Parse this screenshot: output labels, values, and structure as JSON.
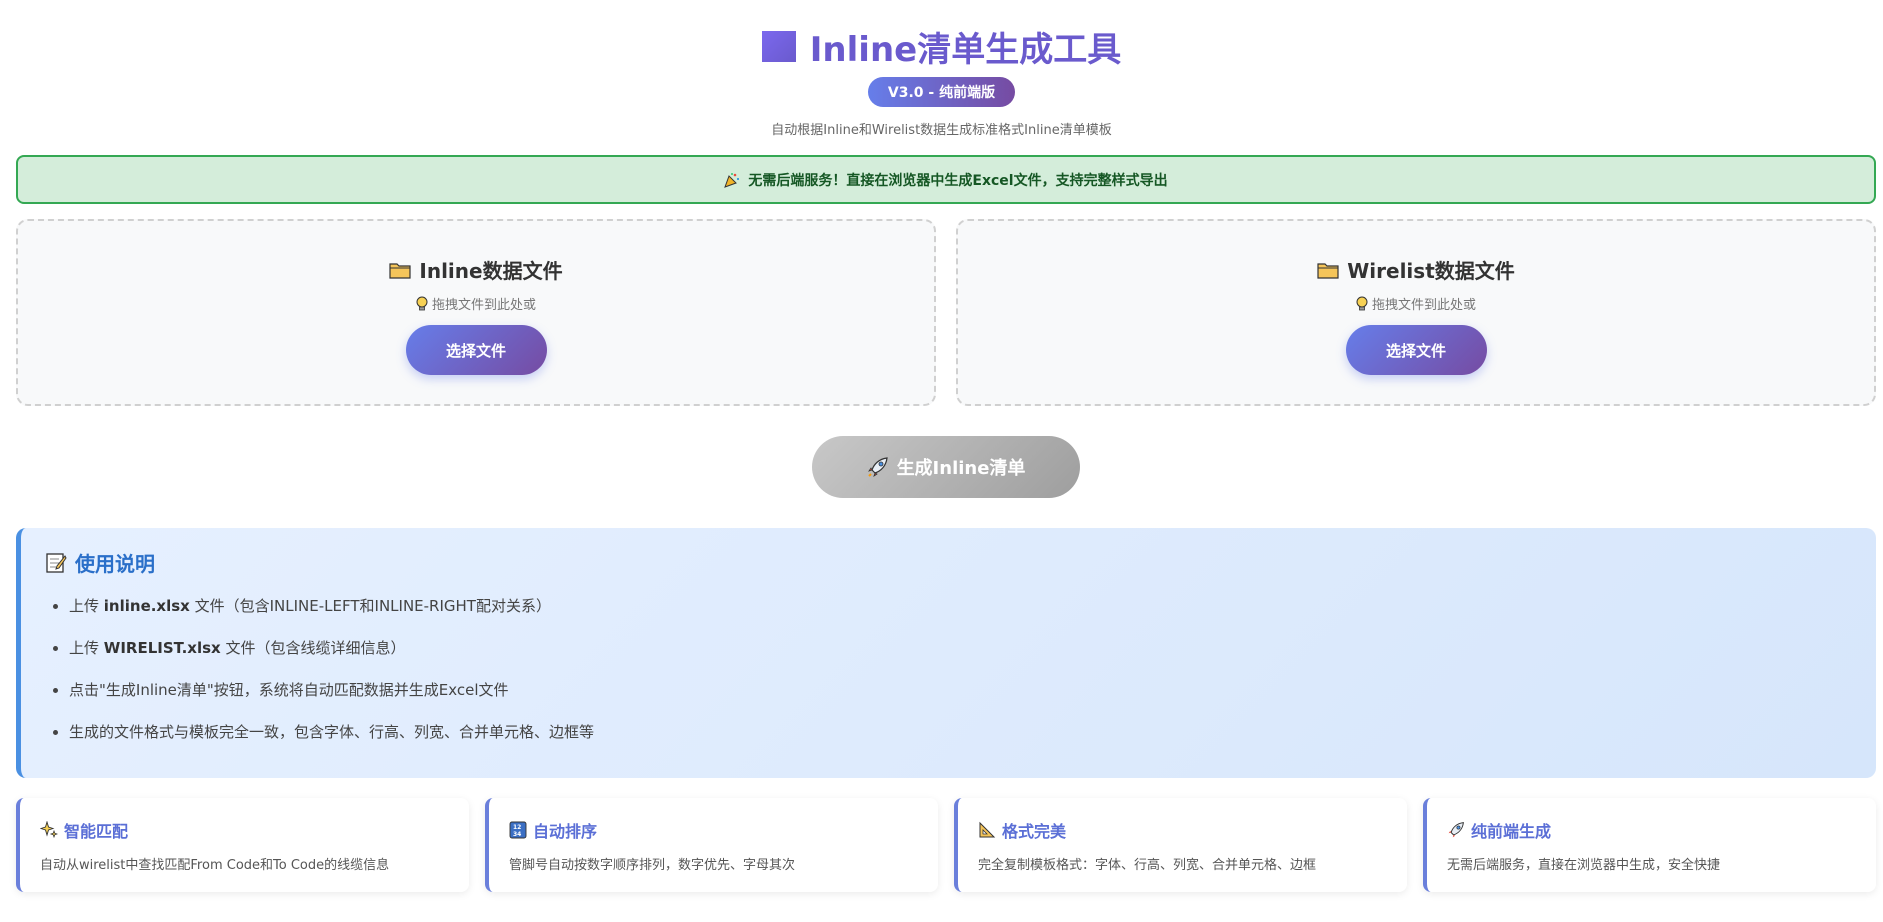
{
  "header": {
    "title": "Inline清单生成工具",
    "version": "V3.0 - 纯前端版",
    "subtitle": "自动根据Inline和Wirelist数据生成标准格式Inline清单模板"
  },
  "notice": {
    "icon": "party-popper-icon",
    "text": "无需后端服务！直接在浏览器中生成Excel文件，支持完整样式导出"
  },
  "uploads": [
    {
      "icon": "folder-icon",
      "title": "Inline数据文件",
      "hint_icon": "lightbulb-icon",
      "hint": "拖拽文件到此处或",
      "button": "选择文件"
    },
    {
      "icon": "folder-icon",
      "title": "Wirelist数据文件",
      "hint_icon": "lightbulb-icon",
      "hint": "拖拽文件到此处或",
      "button": "选择文件"
    }
  ],
  "generate": {
    "icon": "rocket-icon",
    "label": "生成Inline清单"
  },
  "instructions": {
    "icon": "memo-icon",
    "title": "使用说明",
    "items": [
      {
        "pre": "上传 ",
        "bold": "inline.xlsx",
        "post": " 文件（包含INLINE-LEFT和INLINE-RIGHT配对关系）"
      },
      {
        "pre": "上传 ",
        "bold": "WIRELIST.xlsx",
        "post": " 文件（包含线缆详细信息）"
      },
      {
        "pre": "点击\"生成Inline清单\"按钮，系统将自动匹配数据并生成Excel文件",
        "bold": "",
        "post": ""
      },
      {
        "pre": "生成的文件格式与模板完全一致，包含字体、行高、列宽、合并单元格、边框等",
        "bold": "",
        "post": ""
      }
    ]
  },
  "features": [
    {
      "icon": "sparkles-icon",
      "title": "智能匹配",
      "desc": "自动从wirelist中查找匹配From Code和To Code的线缆信息"
    },
    {
      "icon": "numbers-icon",
      "title": "自动排序",
      "desc": "管脚号自动按数字顺序排列，数字优先、字母其次"
    },
    {
      "icon": "triangle-ruler-icon",
      "title": "格式完美",
      "desc": "完全复制模板格式：字体、行高、列宽、合并单元格、边框"
    },
    {
      "icon": "rocket-icon",
      "title": "纯前端生成",
      "desc": "无需后端服务，直接在浏览器中生成，安全快捷"
    }
  ],
  "colors": {
    "accent": "#6a5acd",
    "notice_bg": "#d4edda",
    "notice_border": "#34a853",
    "instructions_accent": "#4a90e2"
  }
}
